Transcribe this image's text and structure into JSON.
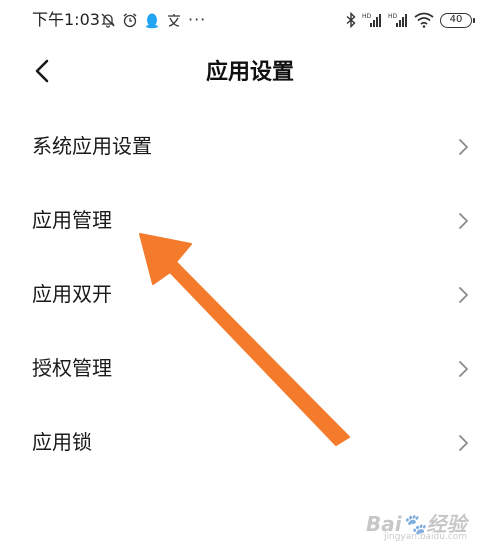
{
  "status_bar": {
    "time": "下午1:03",
    "left_icons": [
      "bell-off-icon",
      "alarm-clock-icon",
      "qq-penguin-icon",
      "input-method-icon"
    ],
    "more": "···",
    "right_icons": [
      "bluetooth-icon",
      "signal-hd-icon",
      "signal-hd-icon",
      "wifi-icon"
    ],
    "battery": "40"
  },
  "header": {
    "back_icon": "chevron-left-icon",
    "title": "应用设置"
  },
  "settings": {
    "items": [
      {
        "label": "系统应用设置"
      },
      {
        "label": "应用管理"
      },
      {
        "label": "应用双开"
      },
      {
        "label": "授权管理"
      },
      {
        "label": "应用锁"
      }
    ]
  },
  "annotation": {
    "arrow_color": "#f47a2c"
  },
  "watermark": {
    "text": "Bai经验",
    "sub": "jingyan.baidu.com"
  }
}
